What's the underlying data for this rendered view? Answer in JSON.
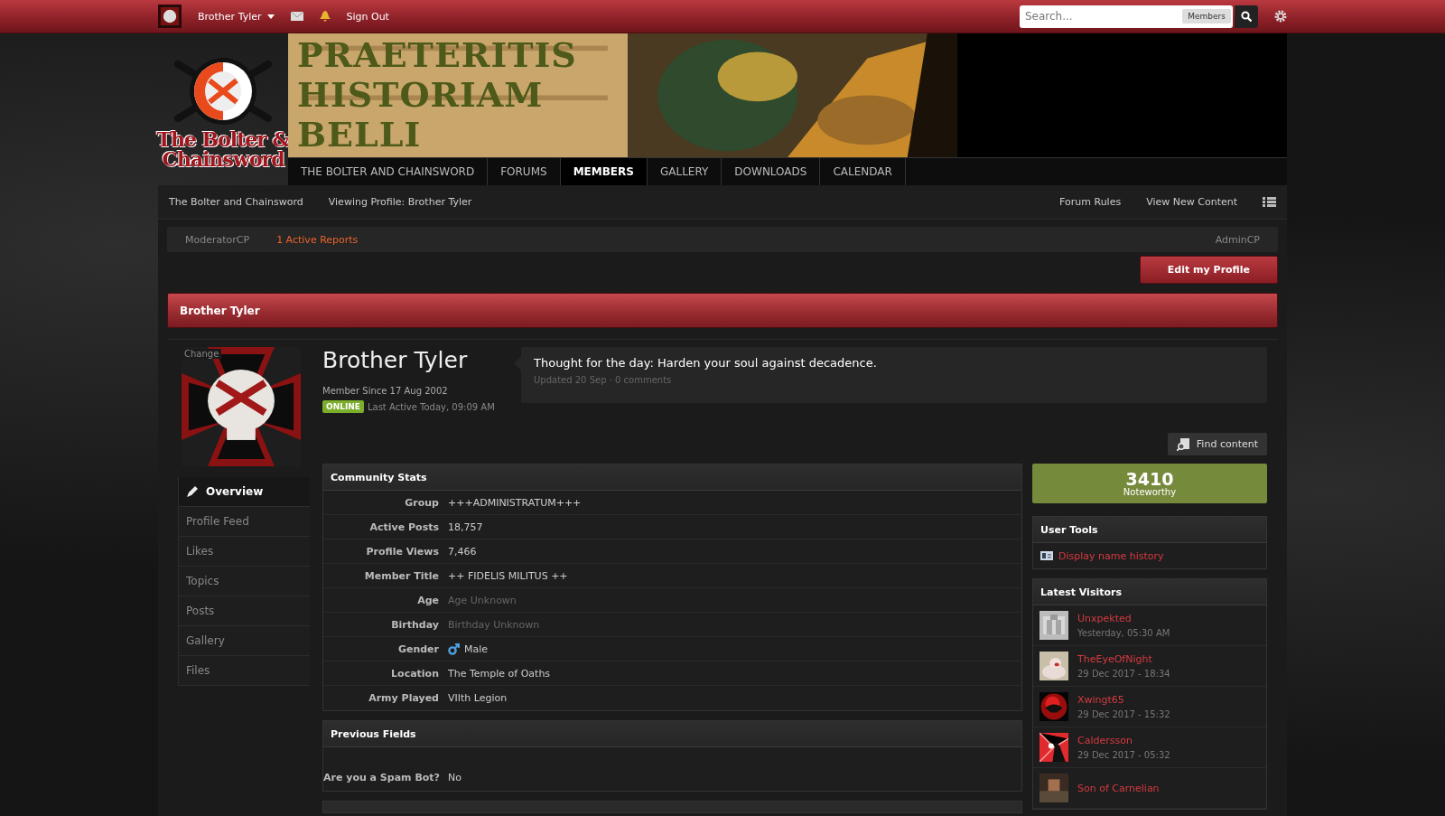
{
  "top_bar": {
    "user_menu": "Brother Tyler",
    "sign_out": "Sign Out",
    "search": {
      "placeholder": "Search...",
      "scope": "Members"
    }
  },
  "logo": {
    "lines": [
      "The Bolter &",
      "Chainsword"
    ]
  },
  "banner": {
    "lines": [
      "PRAETERITIS",
      "HISTORIAM",
      "BELLI"
    ]
  },
  "nav": [
    {
      "label": "THE BOLTER AND CHAINSWORD",
      "selected": false
    },
    {
      "label": "FORUMS",
      "selected": false
    },
    {
      "label": "MEMBERS",
      "selected": true
    },
    {
      "label": "GALLERY",
      "selected": false
    },
    {
      "label": "DOWNLOADS",
      "selected": false
    },
    {
      "label": "CALENDAR",
      "selected": false
    }
  ],
  "breadcrumbs": [
    "The Bolter and Chainsword",
    "Viewing Profile: Brother Tyler"
  ],
  "header_links": [
    "Forum Rules",
    "View New Content"
  ],
  "mod_bar": {
    "links": [
      {
        "label": "ModeratorCP",
        "kind": "plain"
      },
      {
        "label": "1 Active Reports",
        "kind": "alert"
      }
    ],
    "admin": "AdminCP"
  },
  "edit_button": "Edit my Profile",
  "page_title": "Brother Tyler",
  "profile": {
    "change_label": "Change",
    "name": "Brother Tyler",
    "member_since": "Member Since 17 Aug 2002",
    "online": true,
    "online_badge": "ONLINE",
    "last_active": "Last Active Today, 09:09 AM",
    "status": {
      "text": "Thought for the day: Harden your soul against decadence.",
      "meta": "Updated 20 Sep · 0 comments"
    }
  },
  "find_content": "Find content",
  "menu": [
    {
      "label": "Overview",
      "selected": true
    },
    {
      "label": "Profile Feed",
      "selected": false
    },
    {
      "label": "Likes",
      "selected": false
    },
    {
      "label": "Topics",
      "selected": false
    },
    {
      "label": "Posts",
      "selected": false
    },
    {
      "label": "Gallery",
      "selected": false
    },
    {
      "label": "Files",
      "selected": false
    }
  ],
  "sections": [
    {
      "title": "Community Stats",
      "fields": [
        {
          "label": "Group",
          "value": "+++ADMINISTRATUM+++",
          "muted": false
        },
        {
          "label": "Active Posts",
          "value": "18,757",
          "muted": false
        },
        {
          "label": "Profile Views",
          "value": "7,466",
          "muted": false
        },
        {
          "label": "Member Title",
          "value": "++ FIDELIS MILITUS ++",
          "muted": false
        },
        {
          "label": "Age",
          "value": "Age Unknown",
          "muted": true
        },
        {
          "label": "Birthday",
          "value": "Birthday Unknown",
          "muted": true
        },
        {
          "label": "Gender",
          "value": "Male",
          "muted": false,
          "kind": "gender"
        },
        {
          "label": "Location",
          "value": "The Temple of Oaths",
          "muted": false
        },
        {
          "label": "Army Played",
          "value": "VIIth Legion",
          "muted": false
        }
      ]
    },
    {
      "title": "Previous Fields",
      "fields": [
        {
          "label": "Are you a Spam Bot?",
          "value": "No",
          "muted": false
        }
      ]
    }
  ],
  "reputation": {
    "value": "3410",
    "label": "Noteworthy"
  },
  "user_tools": {
    "title": "User Tools",
    "links": [
      "Display name history"
    ]
  },
  "latest_visitors": {
    "title": "Latest Visitors",
    "items": [
      {
        "name": "Unxpekted",
        "time": "Yesterday, 05:30 AM"
      },
      {
        "name": "TheEyeOfNight",
        "time": "29 Dec 2017 - 18:34"
      },
      {
        "name": "Xwingt65",
        "time": "29 Dec 2017 - 15:32"
      },
      {
        "name": "Caldersson",
        "time": "29 Dec 2017 - 05:32"
      },
      {
        "name": "Son of Carnelian"
      }
    ]
  }
}
